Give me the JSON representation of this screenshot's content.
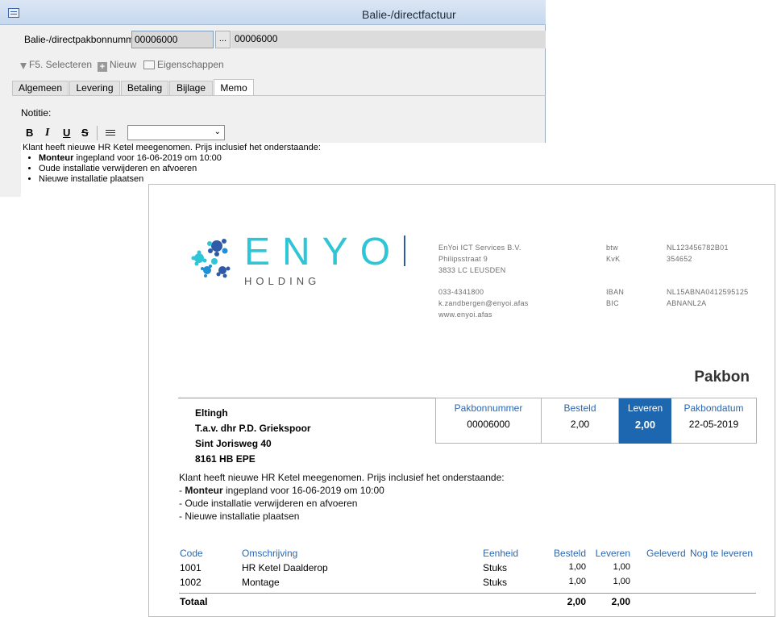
{
  "window": {
    "title": "Balie-/directfactuur",
    "pakbon_label": "Balie-/directpakbonnummer:",
    "pakbon_value": "00006000",
    "browse_label": "...",
    "pakbon_desc": "00006000"
  },
  "toolbar": {
    "select_label": "F5. Selecteren",
    "new_label": "Nieuw",
    "properties_label": "Eigenschappen"
  },
  "tabs": [
    {
      "label": "Algemeen",
      "active": false
    },
    {
      "label": "Levering",
      "active": false
    },
    {
      "label": "Betaling",
      "active": false
    },
    {
      "label": "Bijlage",
      "active": false
    },
    {
      "label": "Memo",
      "active": true
    }
  ],
  "memo": {
    "label": "Notitie:",
    "bold": "B",
    "italic": "I",
    "underline": "U",
    "strike": "S",
    "style_value": "",
    "intro": "Klant heeft nieuwe HR Ketel meegenomen. Prijs inclusief het onderstaande:",
    "item1_bold": "Monteur",
    "item1_rest": " ingepland voor 16-06-2019 om 10:00",
    "item2": "Oude installatie verwijderen en afvoeren",
    "item3": "Nieuwe installatie plaatsen"
  },
  "document": {
    "logo_text": "ENYO",
    "logo_sub": "HOLDING",
    "company_name": "EnYoi ICT Services B.V.",
    "company_street": "Philipsstraat 9",
    "company_city": "3833 LC LEUSDEN",
    "company_phone": "033-4341800",
    "company_email": "k.zandbergen@enyoi.afas",
    "company_web": "www.enyoi.afas",
    "btw_label": "btw",
    "btw_value": "NL123456782B01",
    "kvk_label": "KvK",
    "kvk_value": "354652",
    "iban_label": "IBAN",
    "iban_value": "NL15ABNA0412595125",
    "bic_label": "BIC",
    "bic_value": "ABNANL2A",
    "title": "Pakbon",
    "customer": {
      "name": "Eltingh",
      "attn": "T.a.v. dhr P.D. Griekspoor",
      "street": "Sint Jorisweg 40",
      "city": "8161 HB  EPE"
    },
    "info": {
      "pakbonnummer_label": "Pakbonnummer",
      "pakbonnummer": "00006000",
      "besteld_label": "Besteld",
      "besteld": "2,00",
      "leveren_label": "Leveren",
      "leveren": "2,00",
      "datum_label": "Pakbondatum",
      "datum": "22-05-2019"
    },
    "notes": {
      "intro": "Klant heeft nieuwe HR Ketel meegenomen. Prijs inclusief het onderstaande:",
      "dash": "- ",
      "line1_bold": "Monteur",
      "line1_rest": " ingepland voor 16-06-2019 om 10:00",
      "line2": "- Oude installatie verwijderen en afvoeren",
      "line3": "- Nieuwe installatie plaatsen"
    },
    "table": {
      "headers": {
        "code": "Code",
        "omschrijving": "Omschrijving",
        "eenheid": "Eenheid",
        "besteld": "Besteld",
        "leveren": "Leveren",
        "geleverd": "Geleverd",
        "nog": "Nog te leveren"
      },
      "rows": [
        {
          "code": "1001",
          "omschrijving": "HR Ketel Daalderop",
          "eenheid": "Stuks",
          "besteld": "1,00",
          "leveren": "1,00"
        },
        {
          "code": "1002",
          "omschrijving": "Montage",
          "eenheid": "Stuks",
          "besteld": "1,00",
          "leveren": "1,00"
        }
      ],
      "total_label": "Totaal",
      "total_besteld": "2,00",
      "total_leveren": "2,00"
    },
    "colors": {
      "accent": "#1d66b0",
      "header_blue": "#2a67b1",
      "logo_cyan": "#2ec5d6"
    }
  }
}
